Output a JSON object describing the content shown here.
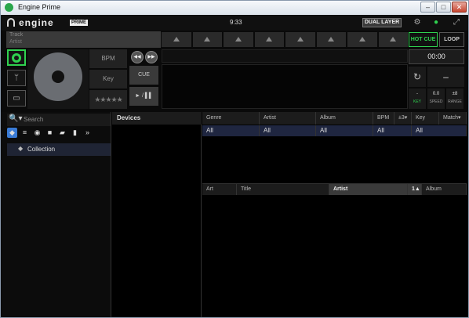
{
  "window": {
    "title": "Engine Prime",
    "minimize": "–",
    "maximize": "□",
    "close": "✕"
  },
  "appbar": {
    "logo_text": "engine",
    "logo_badge": "PRIME",
    "clock": "9:33",
    "dual_layer": "DUAL LAYER",
    "icons": [
      "gear-icon",
      "info-icon",
      "fullscreen-icon"
    ]
  },
  "deck": {
    "track_title": "Track",
    "track_artist": "Artist",
    "hot_cue": "HOT CUE",
    "loop": "LOOP",
    "bpm_label": "BPM",
    "key_label": "Key",
    "rating": "★★★★★",
    "cue": "CUE",
    "play_pause": "► / ▌▌",
    "time": "00:00",
    "sync_glyph": "↻",
    "dash": "–",
    "key_value": "-",
    "key_param": "KEY",
    "speed_value": "0.0",
    "speed_param": "SPEED",
    "range_value": "±8",
    "range_param": "RANGE",
    "colors": {
      "accent": "#2fd14f",
      "selection": "#1f2640"
    }
  },
  "sidebar": {
    "search_placeholder": "Search",
    "search_glyph": "🔍▾",
    "collection": "Collection",
    "more_glyph": "»"
  },
  "devices": {
    "header": "Devices"
  },
  "filters": {
    "headers": [
      "Genre",
      "Artist",
      "Album",
      "BPM",
      "±3▾",
      "Key",
      "Match▾"
    ],
    "values": [
      "All",
      "All",
      "All",
      "All",
      "All"
    ]
  },
  "tracks": {
    "headers": [
      "Art",
      "Title",
      "Artist",
      "1▲",
      "Album"
    ]
  }
}
